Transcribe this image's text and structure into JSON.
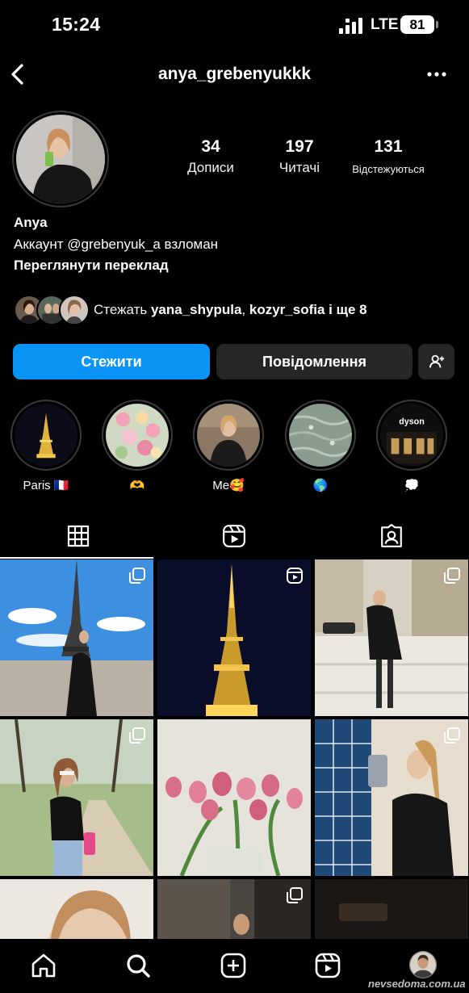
{
  "status_bar": {
    "time": "15:24",
    "network": "LTE",
    "battery": "81"
  },
  "header": {
    "username": "anya_grebenyukkk",
    "icons": {
      "back": "chevron-left-icon",
      "more": "ellipsis-icon"
    }
  },
  "profile": {
    "stats": [
      {
        "number": "34",
        "label": "Дописи"
      },
      {
        "number": "197",
        "label": "Читачі"
      },
      {
        "number": "131",
        "label": "Відстежуються"
      }
    ],
    "name": "Anya",
    "bio": "Аккаунт @grebenyuk_a взломан",
    "translate_link": "Переглянути переклад",
    "followed_by": {
      "prefix": "Стежать",
      "user1": "yana_shypula",
      "separator": ",",
      "user2": "kozyr_sofia",
      "suffix": "і ще 8"
    }
  },
  "buttons": {
    "follow": "Стежити",
    "message": "Повідомлення",
    "suggest_icon": "add-person-icon"
  },
  "highlights": [
    {
      "label": "Paris 🇫🇷"
    },
    {
      "label": "🫶"
    },
    {
      "label": "Me🥰"
    },
    {
      "label": "🌎"
    },
    {
      "label": "💭"
    }
  ],
  "highlight_texts": {
    "dyson": "dyson"
  },
  "tabs": [
    {
      "icon": "grid-icon",
      "active": true
    },
    {
      "icon": "reels-icon",
      "active": false
    },
    {
      "icon": "tagged-icon",
      "active": false
    }
  ],
  "bottom_nav": [
    "home-icon",
    "search-icon",
    "create-icon",
    "reels-icon",
    "profile-avatar"
  ],
  "watermark": "nevsedoma.com.ua",
  "colors": {
    "accent": "#0a95f6",
    "secondary_button": "#262626",
    "background": "#000000"
  }
}
